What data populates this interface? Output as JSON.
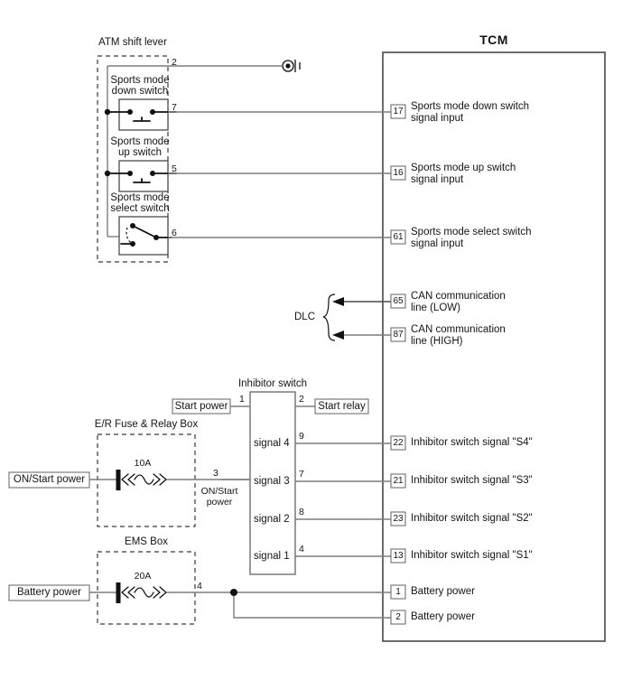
{
  "diagram": {
    "title": "TCM",
    "type": "automotive-wiring-diagram"
  },
  "groups": {
    "atm_shift_lever": {
      "label": "ATM shift lever",
      "switches": [
        {
          "name": "Sports mode down switch",
          "line1": "Sports mode",
          "line2": "down switch",
          "pin": "7",
          "kind": "momentary"
        },
        {
          "name": "Sports mode up switch",
          "line1": "Sports mode",
          "line2": "up switch",
          "pin": "5",
          "kind": "momentary"
        },
        {
          "name": "Sports mode select switch",
          "line1": "Sports mode",
          "line2": "select switch",
          "pin": "6",
          "kind": "spdt"
        }
      ],
      "ground_pin": "2"
    },
    "er_fuse_relay_box": {
      "label": "E/R Fuse & Relay Box",
      "fuse_rating": "10A",
      "source_label": "ON/Start power",
      "out_pin": "3",
      "out_label_line1": "ON/Start",
      "out_label_line2": "power"
    },
    "ems_box": {
      "label": "EMS Box",
      "fuse_rating": "20A",
      "source_label": "Battery power",
      "out_pin": "4"
    },
    "inhibitor_switch": {
      "label": "Inhibitor switch",
      "left_pins": [
        {
          "pin": "1",
          "label": ""
        },
        {
          "pin": "3",
          "label": ""
        }
      ],
      "start_power_label": "Start power",
      "start_relay_label": "Start relay",
      "top_right_pin": "2",
      "signals": [
        {
          "label": "signal 4",
          "pin": "9"
        },
        {
          "label": "signal 3",
          "pin": "7"
        },
        {
          "label": "signal 2",
          "pin": "8"
        },
        {
          "label": "signal 1",
          "pin": "4"
        }
      ]
    },
    "dlc": {
      "label": "DLC"
    }
  },
  "tcm": {
    "title": "TCM",
    "pins": [
      {
        "pin": "17",
        "line1": "Sports mode down switch",
        "line2": "signal input"
      },
      {
        "pin": "16",
        "line1": "Sports mode up switch",
        "line2": "signal input"
      },
      {
        "pin": "61",
        "line1": "Sports mode select switch",
        "line2": "signal input"
      },
      {
        "pin": "65",
        "line1": "CAN communication",
        "line2": "line (LOW)"
      },
      {
        "pin": "87",
        "line1": "CAN communication",
        "line2": "line (HIGH)"
      },
      {
        "pin": "22",
        "line1": "Inhibitor switch signal \"S4\"",
        "line2": ""
      },
      {
        "pin": "21",
        "line1": "Inhibitor switch signal \"S3\"",
        "line2": ""
      },
      {
        "pin": "23",
        "line1": "Inhibitor switch signal \"S2\"",
        "line2": ""
      },
      {
        "pin": "13",
        "line1": "Inhibitor switch signal \"S1\"",
        "line2": ""
      },
      {
        "pin": "1",
        "line1": "Battery power",
        "line2": ""
      },
      {
        "pin": "2",
        "line1": "Battery power",
        "line2": ""
      }
    ]
  },
  "colors": {
    "wire": "#7d7d7d",
    "frame": "#5d5d5d",
    "ink": "#141414",
    "background": "#ffffff"
  }
}
